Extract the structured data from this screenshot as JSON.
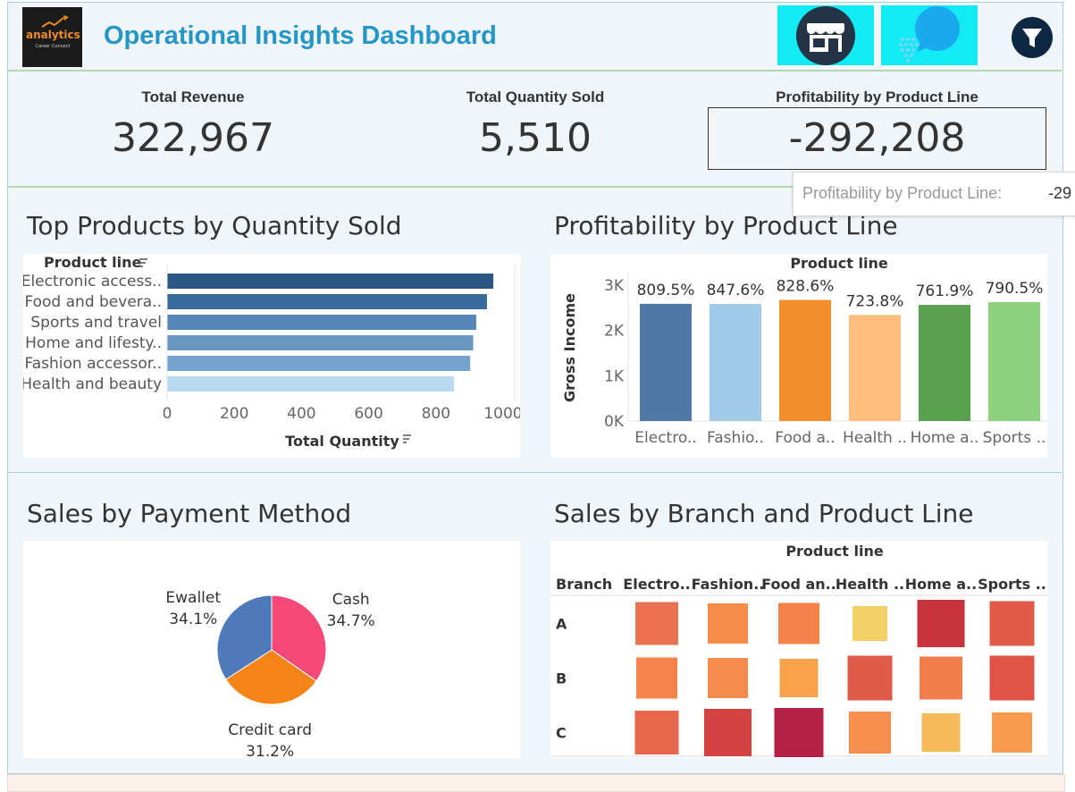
{
  "header": {
    "logo_text": "analytics",
    "logo_subtext": "Career Connect",
    "title": "Operational Insights Dashboard",
    "icons": [
      "store-icon",
      "chat-bubble-icon",
      "filter-icon"
    ]
  },
  "kpis": {
    "total_revenue_label": "Total Revenue",
    "total_revenue_value": "322,967",
    "total_quantity_label": "Total Quantity Sold",
    "total_quantity_value": "5,510",
    "profitability_label": "Profitability by Product Line",
    "profitability_value": "-292,208"
  },
  "tooltip": {
    "label": "Profitability by Product Line:",
    "value": "-29"
  },
  "sections": {
    "top_products": "Top Products by Quantity Sold",
    "profitability": "Profitability by Product Line",
    "payment": "Sales by Payment Method",
    "branch": "Sales by Branch and Product Line"
  },
  "chart_data": [
    {
      "type": "bar",
      "orientation": "horizontal",
      "title": "Top Products by Quantity Sold",
      "ylabel": "Product line",
      "xlabel": "Total Quantity",
      "categories": [
        "Electronic access..",
        "Food and bevera..",
        "Sports and travel",
        "Home and lifesty..",
        "Fashion accessor..",
        "Health and beauty"
      ],
      "values": [
        971,
        952,
        920,
        911,
        902,
        854
      ],
      "colors": [
        "#2a5783",
        "#38699b",
        "#5585b6",
        "#6898c1",
        "#74a4ce",
        "#b7daf0"
      ],
      "xticks": [
        "0",
        "200",
        "400",
        "600",
        "800",
        "1000"
      ],
      "xlim": [
        0,
        1000
      ]
    },
    {
      "type": "bar",
      "title": "Profitability by Product Line",
      "header": "Product line",
      "ylabel": "Gross Income",
      "categories": [
        "Electro..",
        "Fashio..",
        "Food a..",
        "Health ..",
        "Home a..",
        "Sports .."
      ],
      "values": [
        2587.5,
        2585.995,
        2673.564,
        2342.559,
        2564.853,
        2624.896
      ],
      "data_labels": [
        "809.5%",
        "847.6%",
        "828.6%",
        "723.8%",
        "761.9%",
        "790.5%"
      ],
      "colors": [
        "#4e79a7",
        "#a0cbe8",
        "#f28e2b",
        "#ffbe7d",
        "#59a14f",
        "#8cd17d"
      ],
      "yticks": [
        "0K",
        "1K",
        "2K",
        "3K"
      ],
      "ylim": [
        0,
        3000
      ]
    },
    {
      "type": "pie",
      "title": "Sales by Payment Method",
      "slices": [
        {
          "label": "Cash",
          "value": 34.7,
          "display": "34.7%",
          "color": "#f6497a"
        },
        {
          "label": "Credit card",
          "value": 31.2,
          "display": "31.2%",
          "color": "#f58518"
        },
        {
          "label": "Ewallet",
          "value": 34.1,
          "display": "34.1%",
          "color": "#4e79ba"
        }
      ]
    },
    {
      "type": "heatmap",
      "title": "Sales by Branch and Product Line",
      "header": "Product line",
      "row_header": "Branch",
      "columns": [
        "Electro..",
        "Fashion..",
        "Food an..",
        "Health ..",
        "Home a..",
        "Sports .."
      ],
      "rows": [
        "A",
        "B",
        "C"
      ],
      "sizes": [
        [
          0.96,
          0.9,
          0.92,
          0.78,
          1.06,
          1.0
        ],
        [
          0.92,
          0.9,
          0.86,
          1.0,
          0.96,
          1.0
        ],
        [
          0.98,
          1.06,
          1.1,
          0.94,
          0.86,
          0.9
        ]
      ],
      "colors": [
        [
          "#ea7150",
          "#f88c4a",
          "#f4804a",
          "#f2d065",
          "#c7323c",
          "#e25a47"
        ],
        [
          "#f4844c",
          "#f58b4d",
          "#f9a24c",
          "#e05a48",
          "#f27e4c",
          "#e05346"
        ],
        [
          "#e6674c",
          "#d34140",
          "#b51f43",
          "#f88e4e",
          "#f5ba5a",
          "#f99b4c"
        ]
      ]
    }
  ]
}
